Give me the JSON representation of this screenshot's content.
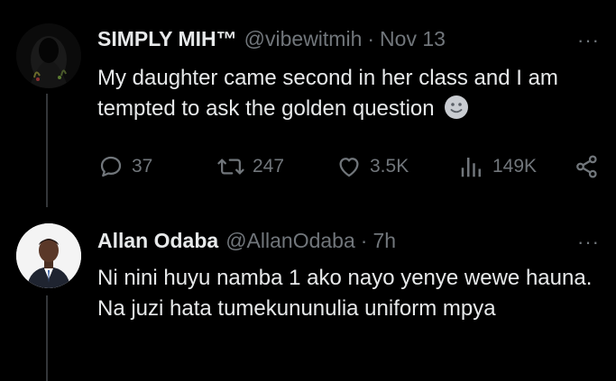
{
  "tweet1": {
    "display_name": "SIMPLY MIH™",
    "handle": "@vibewitmih",
    "separator": "·",
    "time": "Nov 13",
    "more": "···",
    "text": "My daughter came second in her class and I am tempted to ask the golden question",
    "emoji_icon": "slightly-smiling-face-icon",
    "actions": {
      "replies": "37",
      "retweets": "247",
      "likes": "3.5K",
      "views": "149K"
    }
  },
  "tweet2": {
    "display_name": "Allan Odaba",
    "handle": "@AllanOdaba",
    "separator": "·",
    "time": "7h",
    "more": "···",
    "text": "Ni nini huyu namba 1 ako nayo yenye wewe hauna. Na juzi hata tumekununulia uniform mpya"
  },
  "colors": {
    "background": "#000000",
    "primary_text": "#e7e9ea",
    "secondary_text": "#71767b",
    "thread_line": "#333639"
  }
}
